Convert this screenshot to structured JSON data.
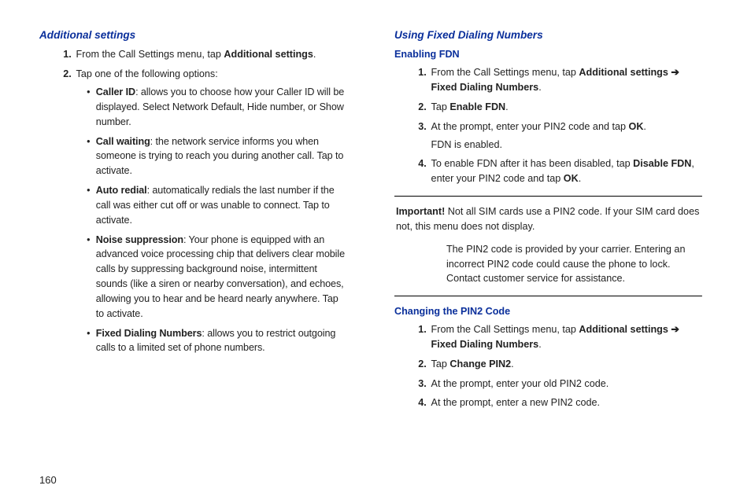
{
  "page_number": "160",
  "left": {
    "heading": "Additional settings",
    "steps": [
      {
        "num": "1.",
        "text_pre": "From the Call Settings menu, tap ",
        "bold": "Additional settings",
        "text_post": "."
      },
      {
        "num": "2.",
        "text_pre": "Tap one of the following options:",
        "bullets": [
          {
            "bold": "Caller ID",
            "rest": ": allows you to choose how your Caller ID will be displayed. Select Network Default, Hide number, or Show number."
          },
          {
            "bold": "Call waiting",
            "rest": ": the network service informs you when someone is trying to reach you during another call. Tap to activate."
          },
          {
            "bold": "Auto redial",
            "rest": ": automatically redials the last number if the call was either cut off or was unable to connect. Tap to activate."
          },
          {
            "bold": "Noise suppression",
            "rest": ": Your phone is equipped with an advanced voice processing chip that delivers clear mobile calls by suppressing background noise, intermittent sounds (like a siren or nearby conversation), and echoes, allowing you to hear and be heard nearly anywhere. Tap to activate."
          },
          {
            "bold": "Fixed Dialing Numbers",
            "rest": ": allows you to restrict outgoing calls to a limited set of phone numbers."
          }
        ]
      }
    ]
  },
  "right": {
    "heading1": "Using Fixed Dialing Numbers",
    "sub1": "Enabling FDN",
    "enable_steps": [
      {
        "num": "1.",
        "pre": "From the Call Settings menu, tap ",
        "b1": "Additional settings",
        "arrow": " ➔ ",
        "b2": "Fixed Dialing Numbers",
        "post": "."
      },
      {
        "num": "2.",
        "pre": "Tap ",
        "b1": "Enable FDN",
        "post": "."
      },
      {
        "num": "3.",
        "pre": "At the prompt, enter your PIN2 code and tap ",
        "b1": "OK",
        "post": ".",
        "extra": "FDN is enabled."
      },
      {
        "num": "4.",
        "pre": "To enable FDN after it has been disabled, tap ",
        "b1": "Disable FDN",
        "post": ", enter your PIN2 code and tap ",
        "b2": "OK",
        "post2": "."
      }
    ],
    "important_label": "Important!",
    "important_p1": " Not all SIM cards use a PIN2 code. If your SIM card does not, this menu does not display.",
    "important_p2": "The PIN2 code is provided by your carrier. Entering an incorrect PIN2 code could cause the phone to lock. Contact customer service for assistance.",
    "sub2": "Changing the PIN2 Code",
    "change_steps": [
      {
        "num": "1.",
        "pre": "From the Call Settings menu, tap ",
        "b1": "Additional settings",
        "arrow": " ➔ ",
        "b2": "Fixed Dialing Numbers",
        "post": "."
      },
      {
        "num": "2.",
        "pre": "Tap ",
        "b1": "Change PIN2",
        "post": "."
      },
      {
        "num": "3.",
        "pre": "At the prompt, enter your old PIN2 code."
      },
      {
        "num": "4.",
        "pre": "At the prompt, enter a new PIN2 code."
      }
    ]
  }
}
